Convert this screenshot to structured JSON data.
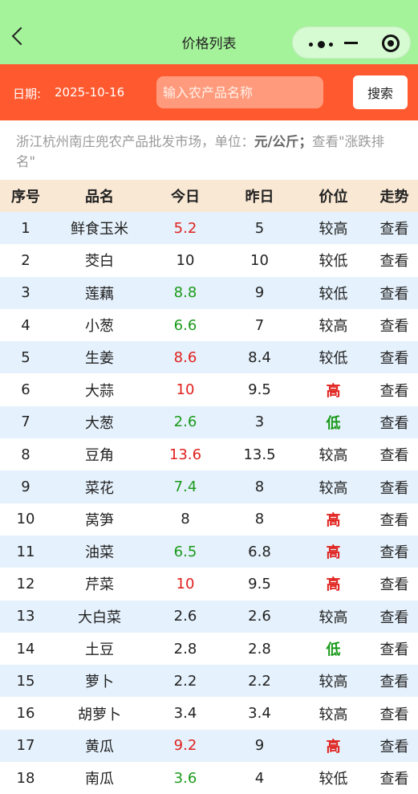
{
  "header": {
    "title": "价格列表"
  },
  "search": {
    "date_label": "日期:",
    "date_value": "2025-10-16",
    "placeholder": "输入农产品名称",
    "button": "搜索"
  },
  "info": {
    "prefix": "浙江杭州南庄兜农产品批发市场，单位：",
    "unit": "元/公斤；",
    "suffix": "查看\"涨跌排名\""
  },
  "table": {
    "headers": [
      "序号",
      "品名",
      "今日",
      "昨日",
      "价位",
      "走势"
    ],
    "rows": [
      {
        "no": "1",
        "name": "鲜食玉米",
        "today": "5.2",
        "yesterday": "5",
        "level": "较高",
        "action": "查看",
        "trend": "up",
        "level_style": "norm"
      },
      {
        "no": "2",
        "name": "茭白",
        "today": "10",
        "yesterday": "10",
        "level": "较低",
        "action": "查看",
        "trend": "eq",
        "level_style": "norm"
      },
      {
        "no": "3",
        "name": "莲藕",
        "today": "8.8",
        "yesterday": "9",
        "level": "较低",
        "action": "查看",
        "trend": "down",
        "level_style": "norm"
      },
      {
        "no": "4",
        "name": "小葱",
        "today": "6.6",
        "yesterday": "7",
        "level": "较高",
        "action": "查看",
        "trend": "down",
        "level_style": "norm"
      },
      {
        "no": "5",
        "name": "生姜",
        "today": "8.6",
        "yesterday": "8.4",
        "level": "较低",
        "action": "查看",
        "trend": "up",
        "level_style": "norm"
      },
      {
        "no": "6",
        "name": "大蒜",
        "today": "10",
        "yesterday": "9.5",
        "level": "高",
        "action": "查看",
        "trend": "up",
        "level_style": "high"
      },
      {
        "no": "7",
        "name": "大葱",
        "today": "2.6",
        "yesterday": "3",
        "level": "低",
        "action": "查看",
        "trend": "down",
        "level_style": "low"
      },
      {
        "no": "8",
        "name": "豆角",
        "today": "13.6",
        "yesterday": "13.5",
        "level": "较高",
        "action": "查看",
        "trend": "up",
        "level_style": "norm"
      },
      {
        "no": "9",
        "name": "菜花",
        "today": "7.4",
        "yesterday": "8",
        "level": "较高",
        "action": "查看",
        "trend": "down",
        "level_style": "norm"
      },
      {
        "no": "10",
        "name": "莴笋",
        "today": "8",
        "yesterday": "8",
        "level": "高",
        "action": "查看",
        "trend": "eq",
        "level_style": "high"
      },
      {
        "no": "11",
        "name": "油菜",
        "today": "6.5",
        "yesterday": "6.8",
        "level": "高",
        "action": "查看",
        "trend": "down",
        "level_style": "high"
      },
      {
        "no": "12",
        "name": "芹菜",
        "today": "10",
        "yesterday": "9.5",
        "level": "高",
        "action": "查看",
        "trend": "up",
        "level_style": "high"
      },
      {
        "no": "13",
        "name": "大白菜",
        "today": "2.6",
        "yesterday": "2.6",
        "level": "较高",
        "action": "查看",
        "trend": "eq",
        "level_style": "norm"
      },
      {
        "no": "14",
        "name": "土豆",
        "today": "2.8",
        "yesterday": "2.8",
        "level": "低",
        "action": "查看",
        "trend": "eq",
        "level_style": "low"
      },
      {
        "no": "15",
        "name": "萝卜",
        "today": "2.2",
        "yesterday": "2.2",
        "level": "较高",
        "action": "查看",
        "trend": "eq",
        "level_style": "norm"
      },
      {
        "no": "16",
        "name": "胡萝卜",
        "today": "3.4",
        "yesterday": "3.4",
        "level": "较高",
        "action": "查看",
        "trend": "eq",
        "level_style": "norm"
      },
      {
        "no": "17",
        "name": "黄瓜",
        "today": "9.2",
        "yesterday": "9",
        "level": "高",
        "action": "查看",
        "trend": "up",
        "level_style": "high"
      },
      {
        "no": "18",
        "name": "南瓜",
        "today": "3.6",
        "yesterday": "4",
        "level": "较低",
        "action": "查看",
        "trend": "down",
        "level_style": "norm"
      }
    ]
  },
  "colors": {
    "topbar": "#a4f39a",
    "searchbar": "#ff5a2f",
    "header_row": "#f9e8d4",
    "stripe": "#e5f1fc",
    "up": "#e0211d",
    "down": "#1a9a1a"
  }
}
